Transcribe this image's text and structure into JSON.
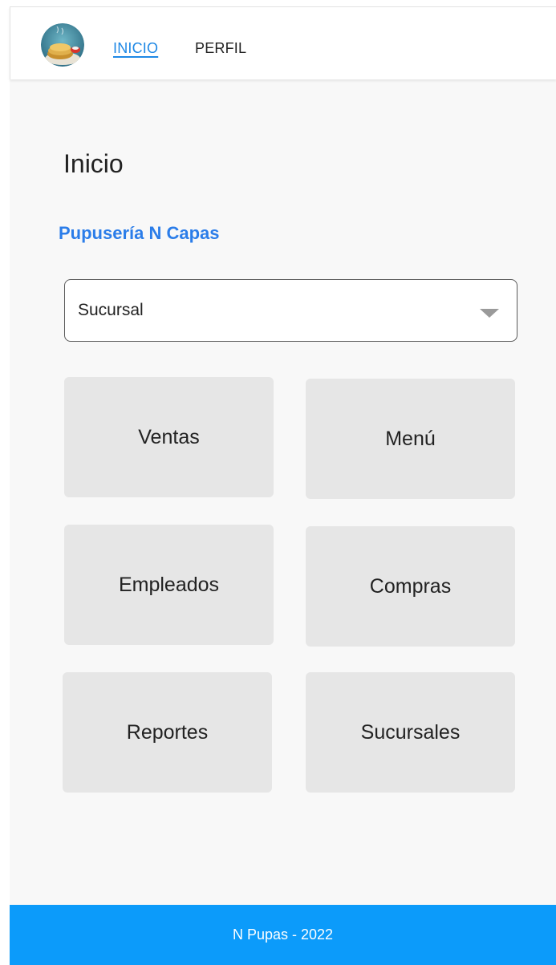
{
  "nav": {
    "links": [
      {
        "label": "INICIO",
        "active": true
      },
      {
        "label": "PERFIL",
        "active": false
      }
    ]
  },
  "main": {
    "title": "Inicio",
    "subtitle": "Pupusería N Capas",
    "branch_select": {
      "value": "Sucursal"
    },
    "tiles": [
      {
        "label": "Ventas"
      },
      {
        "label": "Menú"
      },
      {
        "label": "Empleados"
      },
      {
        "label": "Compras"
      },
      {
        "label": "Reportes"
      },
      {
        "label": "Sucursales"
      }
    ]
  },
  "footer": {
    "text": "N Pupas - 2022"
  },
  "colors": {
    "accent": "#1e88e5",
    "subtitle": "#2b7de9",
    "footer": "#0c9bfa",
    "tile": "#e6e6e6",
    "page_bg": "#f8f8f8"
  },
  "icons": {
    "logo": "pupusa-plate-logo",
    "select_arrow": "caret-down-icon"
  }
}
